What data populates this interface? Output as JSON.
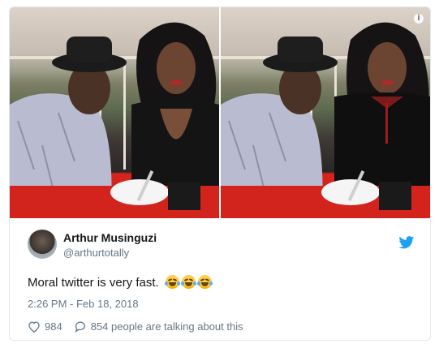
{
  "tweet": {
    "author_name": "Arthur Musinguzi",
    "author_handle": "@arthurtotally",
    "text": "Moral twitter is very fast.",
    "emojis": [
      "face-with-tears-of-joy",
      "face-with-tears-of-joy",
      "face-with-tears-of-joy"
    ],
    "timestamp": "2:26 PM - Feb 18, 2018",
    "likes": "984",
    "conversation_label": "854 people are talking about this"
  },
  "media": {
    "photos": [
      "couple-photo-original",
      "couple-photo-edited"
    ],
    "info_icon": "info-icon"
  },
  "colors": {
    "border": "#e1e8ed",
    "secondary_text": "#657786",
    "twitter_blue": "#1da1f2"
  }
}
